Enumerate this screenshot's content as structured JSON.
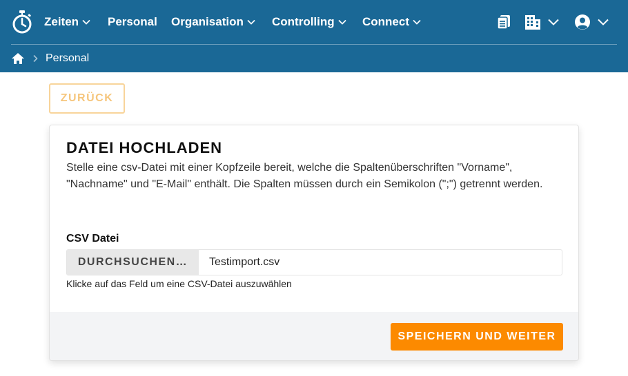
{
  "nav": {
    "logo_icon": "stopwatch-logo-icon",
    "items": [
      {
        "label": "Zeiten",
        "has_dropdown": true
      },
      {
        "label": "Personal",
        "has_dropdown": false
      },
      {
        "label": "Organisation",
        "has_dropdown": true
      },
      {
        "label": "Controlling",
        "has_dropdown": true
      },
      {
        "label": "Connect",
        "has_dropdown": true
      }
    ],
    "right_icons": [
      "clipboard-icon",
      "building-icon",
      "user-account-icon"
    ]
  },
  "breadcrumb": {
    "home_icon": "home-icon",
    "current": "Personal"
  },
  "back_button": {
    "label": "ZURÜCK"
  },
  "upload": {
    "title": "DATEI HOCHLADEN",
    "description": "Stelle eine csv-Datei mit einer Kopfzeile bereit, welche die Spaltenüberschriften \"Vorname\", \"Nachname\" und \"E-Mail\" enthält. Die Spalten müssen durch ein Semikolon (\";\") getrennt werden.",
    "field_label": "CSV Datei",
    "browse_label": "DURCHSUCHEN…",
    "file_name": "Testimport.csv",
    "help_text": "Klicke auf das Feld um eine CSV-Datei auszuwählen",
    "save_label": "SPEICHERN UND WEITER"
  },
  "colors": {
    "header_bg": "#1a6896",
    "accent_orange": "#fc8a00",
    "back_button_border": "#f8d49a",
    "footer_bg": "#f3f4f6"
  }
}
